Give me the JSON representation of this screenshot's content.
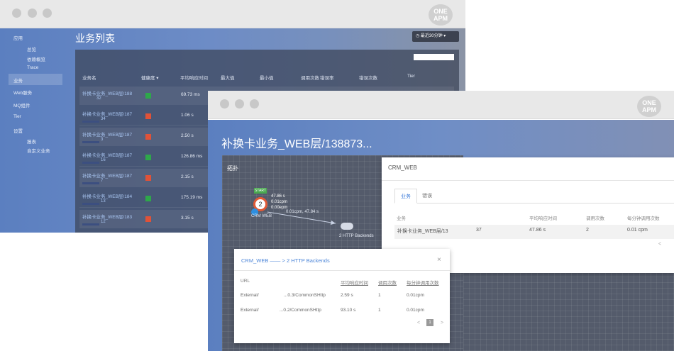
{
  "back_window": {
    "logo_line1": "ONE",
    "logo_line2": "APM",
    "sidebar": {
      "items": [
        {
          "label": "应用"
        },
        {
          "label": "总览"
        },
        {
          "label": "依赖概览"
        },
        {
          "label": "Trace"
        },
        {
          "label": "业务"
        },
        {
          "label": "Web服务"
        },
        {
          "label": "MQ组件"
        },
        {
          "label": "Tier"
        },
        {
          "label": "设置"
        },
        {
          "label": "报表"
        },
        {
          "label": "自定义业务"
        }
      ]
    },
    "page_title": "业务列表",
    "time_dropdown_label": "最近30分钟 ▾",
    "table": {
      "headers": [
        "业务名",
        "健康度 ▾",
        "平均响应时间",
        "最大值",
        "最小值",
        "调用次数",
        "错误率",
        "错误次数",
        "Tier"
      ],
      "rows": [
        {
          "name": "补换卡业务_WEB层/188",
          "sub": "32",
          "health": "#2ea84a",
          "rt": "69.73 ms"
        },
        {
          "name": "补换卡业务_WEB层/187",
          "sub": "34",
          "health": "#e05238",
          "rt": "1.06 s"
        },
        {
          "name": "补换卡业务_WEB层/187",
          "sub": "3",
          "health": "#e05238",
          "rt": "2.50 s"
        },
        {
          "name": "补换卡业务_WEB层/187",
          "sub": "16",
          "health": "#2ea84a",
          "rt": "126.86 ms"
        },
        {
          "name": "补换卡业务_WEB层/187",
          "sub": "7",
          "health": "#e05238",
          "rt": "2.15 s"
        },
        {
          "name": "补换卡业务_WEB层/184",
          "sub": "13",
          "health": "#2ea84a",
          "rt": "175.19 ms"
        },
        {
          "name": "补换卡业务_WEB层/183",
          "sub": "12",
          "health": "#e05238",
          "rt": "3.15 s"
        }
      ]
    }
  },
  "front_window": {
    "logo_line1": "ONE",
    "logo_line2": "APM",
    "title": "补换卡业务_WEB层/138873...",
    "topology": {
      "label": "拓扑",
      "start_label": "START",
      "node_count": "2",
      "node_stat_1": "47.86 s",
      "node_stat_2": "0.01cpm",
      "node_stat_3": "0.00epm",
      "node_name": "CRM WEB",
      "edge_label": "0.01cpm, 47.84 s",
      "backend_label": "2 HTTP Backends"
    },
    "detail_panel": {
      "title": "CRM_WEB",
      "tabs": [
        "业务",
        "错误"
      ],
      "headers": [
        "业务",
        "平均响应时间",
        "调用次数",
        "每分钟调用次数"
      ],
      "row": {
        "name": "补换卡业务_WEB层/13",
        "name_suffix": "37",
        "rt": "47.86 s",
        "calls": "2",
        "cpm": "0.01 cpm"
      },
      "pager": "<"
    },
    "modal": {
      "title": "CRM_WEB —— > 2 HTTP Backends",
      "close": "×",
      "headers": [
        "URL",
        "平均响应时间",
        "调用次数",
        "每分钟调用次数"
      ],
      "rows": [
        {
          "url": "External/",
          "url2": "...0.3/CommonSHttp",
          "rt": "2.59 s",
          "calls": "1",
          "cpm": "0.01cpm"
        },
        {
          "url": "External/",
          "url2": "...0.2/CommonSHttp",
          "rt": "93.10 s",
          "calls": "1",
          "cpm": "0.01cpm"
        }
      ],
      "pager_prev": "<",
      "pager_page": "1",
      "pager_next": ">"
    }
  }
}
